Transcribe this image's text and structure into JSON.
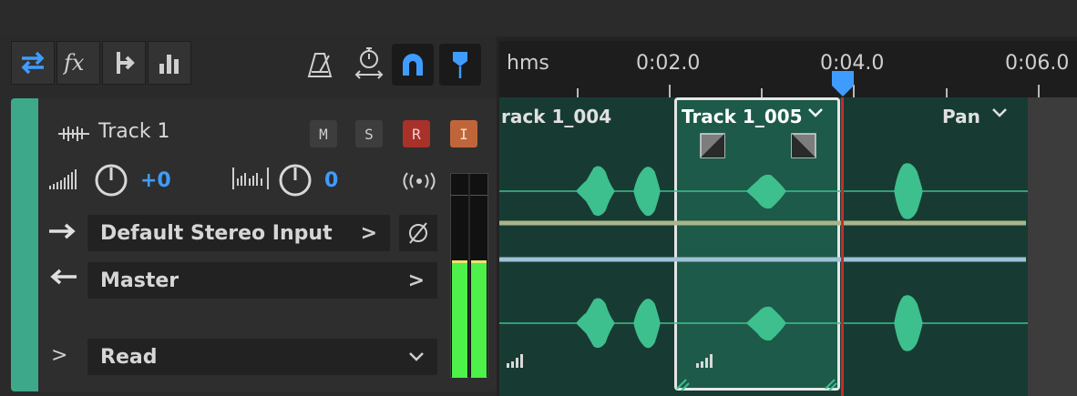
{
  "toolbar": {
    "icons": [
      "inputs-outputs-icon",
      "effects-icon",
      "sends-icon",
      "eq-icon"
    ],
    "right_icons": [
      "metronome-icon",
      "punch-icon",
      "snap-magnet-icon",
      "marker-pin-icon"
    ]
  },
  "ruler": {
    "unit_label": "hms",
    "ticks": [
      "0:02.0",
      "0:04.0",
      "0:06.0"
    ]
  },
  "track": {
    "name": "Track 1",
    "buttons": {
      "mute": "M",
      "solo": "S",
      "record": "R",
      "input": "I"
    },
    "volume": "+0",
    "pan": "0",
    "input": "Default Stereo Input",
    "output": "Master",
    "automation": "Read",
    "chevron": ">",
    "collapse_chevron": ">"
  },
  "clips": [
    {
      "name": "rack 1_004"
    },
    {
      "name": "Track 1_005",
      "selected": true
    }
  ],
  "envelope_label": "Pan",
  "colors": {
    "track_accent": "#3ea98a",
    "clip_bg": "#173b33",
    "selected_clip_bg": "#1d5a4a",
    "waveform": "#3ebf8e",
    "blue": "#3f9cff",
    "record": "#a8312a",
    "input": "#c0653a",
    "playhead": "#c72b2b",
    "meter": "#4ef04a"
  }
}
